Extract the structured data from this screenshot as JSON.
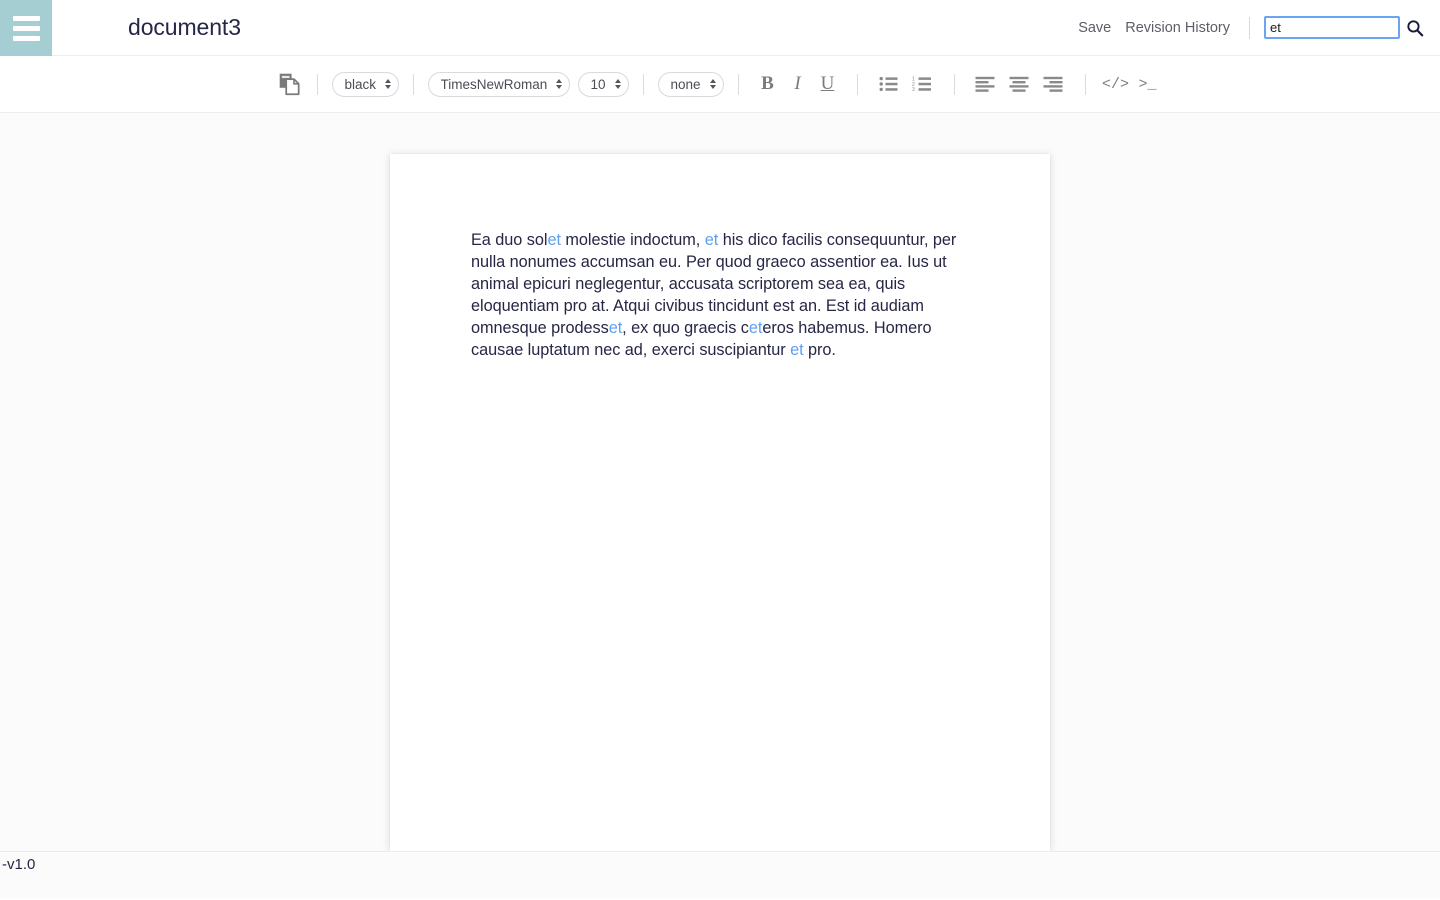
{
  "header": {
    "menu_icon": "hamburger-menu-icon",
    "document_title": "document3",
    "save_label": "Save",
    "revision_history_label": "Revision History",
    "search": {
      "value": "et",
      "placeholder": "",
      "icon": "search-icon"
    }
  },
  "toolbar": {
    "copy_icon": "copy-document-icon",
    "color_select": {
      "value": "black",
      "options": [
        "black"
      ]
    },
    "font_select": {
      "value": "TimesNewRoman",
      "options": [
        "TimesNewRoman"
      ]
    },
    "size_select": {
      "value": "10",
      "options": [
        "10"
      ]
    },
    "style_select": {
      "value": "none",
      "options": [
        "none"
      ]
    },
    "bold_label": "B",
    "italic_label": "I",
    "underline_label": "U",
    "bullet_list_icon": "bullet-list-icon",
    "numbered_list_icon": "numbered-list-icon",
    "align_left_icon": "align-left-icon",
    "align_center_icon": "align-center-icon",
    "align_right_icon": "align-right-icon",
    "code_label": "</>",
    "terminal_label": ">_"
  },
  "document": {
    "paragraph": {
      "seg1": "Ea duo sol",
      "m1": "et",
      "seg2": " molestie indoctum, ",
      "m2": "et",
      "seg3": " his dico facilis consequuntur, per nulla nonumes accumsan eu. Per quod graeco assentior ea. Ius ut animal epicuri neglegentur, accusata scriptorem sea ea, quis eloquentiam pro at. Atqui civibus tincidunt est an. Est id audiam omnesque prodess",
      "m3": "et",
      "seg4": ", ex quo graecis c",
      "m4": "et",
      "seg5": "eros habemus. Homero causae luptatum nec ad, exerci suscipiantur ",
      "m5": "et",
      "seg6": " pro."
    }
  },
  "footer": {
    "version": "-v1.0"
  },
  "colors": {
    "accent_teal": "#a5ced3",
    "text_navy": "#262645",
    "match_blue": "#5f9ff2",
    "focus_blue": "#6aa5f4",
    "toolbar_gray": "#7b7b7b"
  }
}
